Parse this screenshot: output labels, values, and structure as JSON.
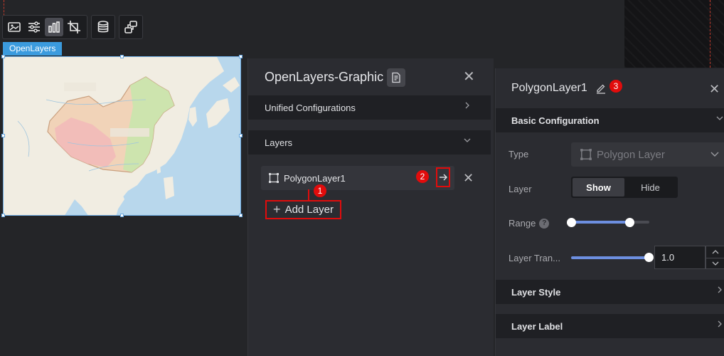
{
  "toolbar": {
    "buttons": [
      {
        "icon": "image-icon"
      },
      {
        "icon": "sliders-icon"
      },
      {
        "icon": "bar-chart-icon",
        "active": true
      },
      {
        "icon": "crop-icon"
      },
      {
        "icon": "database-icon"
      },
      {
        "icon": "link-icon"
      }
    ]
  },
  "component_tag": "OpenLayers",
  "graphic_panel": {
    "title": "OpenLayers-Graphic",
    "sections": {
      "unified": "Unified Configurations",
      "layers": "Layers"
    },
    "layer_items": [
      {
        "label": "PolygonLayer1"
      }
    ],
    "add_layer_label": "Add Layer"
  },
  "layer_panel": {
    "title": "PolygonLayer1",
    "basic_section": "Basic Configuration",
    "type_label": "Type",
    "type_value": "Polygon Layer",
    "layer_label": "Layer",
    "show_label": "Show",
    "hide_label": "Hide",
    "range_label": "Range",
    "range_value": [
      0,
      0.7
    ],
    "transparency_label": "Layer Tran...",
    "transparency_value": "1.0",
    "layer_style_section": "Layer Style",
    "layer_label_section": "Layer Label"
  },
  "annotations": {
    "badge_1": "1",
    "badge_2": "2",
    "badge_3": "3"
  },
  "colors": {
    "accent_blue": "#3b9bde",
    "annotation_red": "#e10c0c",
    "slider_fill": "#6d8fe0"
  }
}
